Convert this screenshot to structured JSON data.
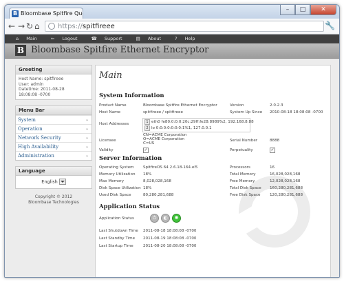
{
  "browser": {
    "tab_title": "Bloombase Spitfire Quorum",
    "favicon": "B",
    "tab_close": "×",
    "url_protocol": "https://",
    "url_host": "spitfireee",
    "win_min": "–",
    "win_max": "□",
    "win_close": "✕"
  },
  "topmenu": {
    "items": [
      "Main",
      "Logout",
      "Support",
      "About",
      "Help"
    ]
  },
  "brand": {
    "logo_letter": "B",
    "title": "Bloombase Spitfire Ethernet Encryptor"
  },
  "greeting": {
    "title": "Greeting",
    "host": "Host Name: spitfireee",
    "user": "User: admin",
    "datetime1": "Datetime: 2011-08-28",
    "datetime2": "18:08:08 -0700"
  },
  "menubar": {
    "title": "Menu Bar",
    "items": [
      "System",
      "Operation",
      "Network Security",
      "High Availability",
      "Administration"
    ]
  },
  "language": {
    "title": "Language",
    "selected": "English"
  },
  "copyright": {
    "line1": "Copyright © 2012",
    "line2": "Bloombase Technologies"
  },
  "main": {
    "title": "Main"
  },
  "system_info": {
    "heading": "System Information",
    "product_name_label": "Product Name",
    "product_name": "Bloombase Spitfire Ethernet Encryptor",
    "version_label": "Version",
    "version": "2.0.2.3",
    "host_name_label": "Host Name",
    "host_name": "spitfireee / spitfireee",
    "up_since_label": "System Up Since",
    "up_since": "2010-08-18 18:08:08 -0700",
    "host_addresses_label": "Host Addresses",
    "addr1_num": "1",
    "addr1": "eth0  fe80:0:0:0:20c:29ff:fe28:8989%2, 192.168.8.88",
    "addr2_num": "2",
    "addr2": "lo    0:0:0:0:0:0:0:1%1, 127.0.0.1",
    "licensee_label": "Licensee",
    "licensee_cn": "CN=ACME Corporation",
    "licensee_o": "O=ACME Corporation",
    "licensee_c": "C=US",
    "serial_label": "Serial Number",
    "serial": "8888",
    "validity_label": "Validity",
    "perpetuality_label": "Perpetuality",
    "check": "✓"
  },
  "server_info": {
    "heading": "Server Information",
    "os_label": "Operating System",
    "os": "SpitfireOS 64 2.6.18-164.el5",
    "processors_label": "Processors",
    "processors": "16",
    "mem_util_label": "Memory Utilization",
    "mem_util": "18%",
    "total_mem_label": "Total Memory",
    "total_mem": "16,028,028,168",
    "max_mem_label": "Max Memory",
    "max_mem": "8,028,028,168",
    "free_mem_label": "Free Memory",
    "free_mem": "12,028,028,168",
    "disk_util_label": "Disk Space Utilization",
    "disk_util": "18%",
    "total_disk_label": "Total Disk Space",
    "total_disk": "160,280,281,688",
    "used_disk_label": "Used Disk Space",
    "used_disk": "80,280,281,688",
    "free_disk_label": "Free Disk Space",
    "free_disk": "120,280,281,688"
  },
  "app_status": {
    "heading": "Application Status",
    "status_label": "Application Status",
    "last_shutdown_label": "Last Shutdown Time",
    "last_shutdown": "2011-08-18 18:08:08 -0700",
    "last_standby_label": "Last Standby Time",
    "last_standby": "2011-08-19 18:08:08 -0700",
    "last_startup_label": "Last Startup Time",
    "last_startup": "2011-08-20 18:08:08 -0700"
  }
}
